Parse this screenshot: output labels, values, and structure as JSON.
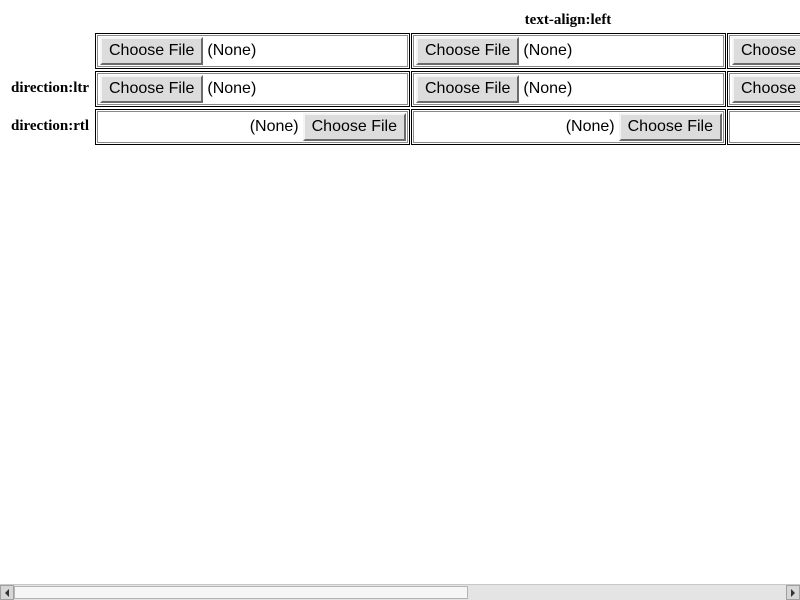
{
  "column_headers": [
    "text-align:left"
  ],
  "row_headers": {
    "ltr": "direction:ltr",
    "rtl": "direction:rtl"
  },
  "file_input": {
    "button_label": "Choose File",
    "button_label_clipped": "Choose",
    "status": "(None)"
  },
  "scrollbar": {
    "orientation": "horizontal",
    "position_fraction": 0.0,
    "visible_fraction": 0.59
  }
}
